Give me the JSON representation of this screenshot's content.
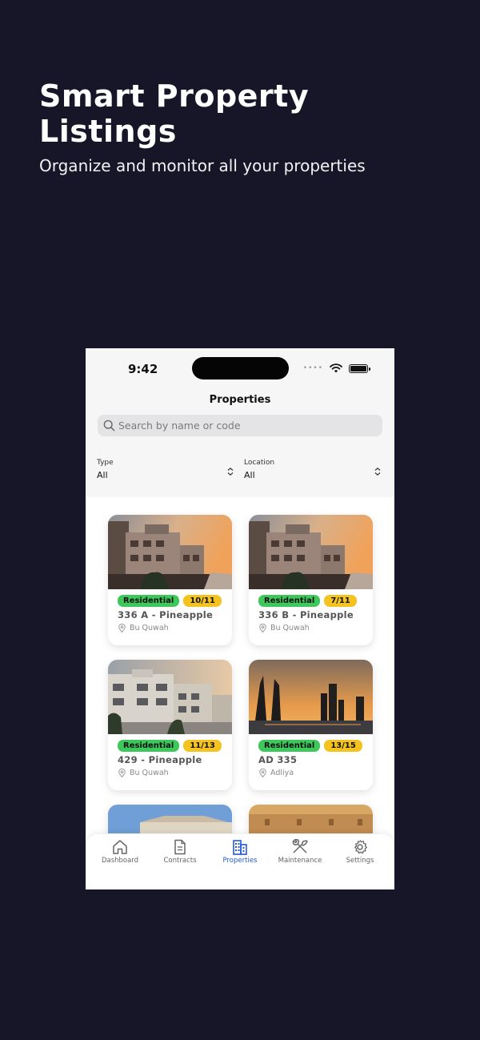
{
  "hero": {
    "title_line1": "Smart Property",
    "title_line2": "Listings",
    "subtitle": "Organize and monitor all your properties"
  },
  "status_bar": {
    "time": "9:42"
  },
  "screen": {
    "title": "Properties",
    "search_placeholder": "Search by name or code"
  },
  "filters": {
    "type": {
      "label": "Type",
      "value": "All"
    },
    "location": {
      "label": "Location",
      "value": "All"
    }
  },
  "properties": [
    {
      "type": "Residential",
      "units": "10/11",
      "name": "336 A - Pineapple",
      "location": "Bu Quwah",
      "image": "building-terraced"
    },
    {
      "type": "Residential",
      "units": "7/11",
      "name": "336 B - Pineapple",
      "location": "Bu Quwah",
      "image": "building-terraced"
    },
    {
      "type": "Residential",
      "units": "11/13",
      "name": "429 - Pineapple",
      "location": "Bu Quwah",
      "image": "building-white"
    },
    {
      "type": "Residential",
      "units": "13/15",
      "name": "AD 335",
      "location": "Adliya",
      "image": "skyline-sunset"
    },
    {
      "image": "building-blue-sky"
    },
    {
      "image": "building-desert"
    }
  ],
  "tabs": [
    {
      "label": "Dashboard",
      "icon": "home-icon",
      "active": false
    },
    {
      "label": "Contracts",
      "icon": "document-icon",
      "active": false
    },
    {
      "label": "Properties",
      "icon": "buildings-icon",
      "active": true
    },
    {
      "label": "Maintenance",
      "icon": "tools-icon",
      "active": false
    },
    {
      "label": "Settings",
      "icon": "gear-icon",
      "active": false
    }
  ],
  "colors": {
    "background": "#161628",
    "residential_tag": "#3cc85a",
    "units_tag": "#f4c31f",
    "active_tab": "#2459d6"
  }
}
